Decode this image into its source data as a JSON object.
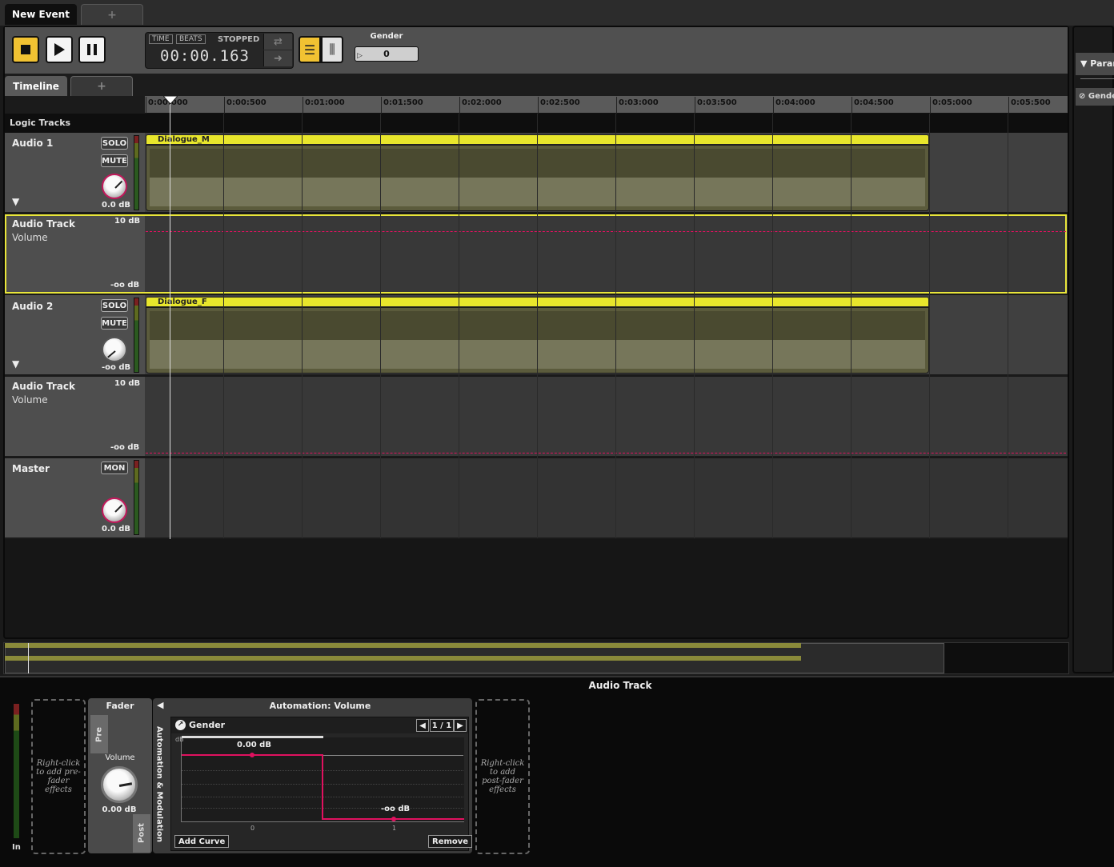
{
  "document_tabs": [
    {
      "label": "New Event"
    },
    {
      "label": "+"
    }
  ],
  "transport": {
    "mode_time": "TIME",
    "mode_beats": "BEATS",
    "status": "STOPPED",
    "time": "00:00.163",
    "loop_icon": "loop-icon",
    "follow_icon": "follow-icon"
  },
  "parameter": {
    "label": "Gender",
    "value": "0"
  },
  "sub_tabs": [
    {
      "label": "Timeline"
    },
    {
      "label": "+"
    }
  ],
  "ruler_ticks": [
    "0:00:000",
    "0:00:500",
    "0:01:000",
    "0:01:500",
    "0:02:000",
    "0:02:500",
    "0:03:000",
    "0:03:500",
    "0:04:000",
    "0:04:500",
    "0:05:000",
    "0:05:500"
  ],
  "logic_tracks_label": "Logic Tracks",
  "tracks": {
    "audio1": {
      "name": "Audio 1",
      "solo": "SOLO",
      "mute": "MUTE",
      "volume": "0.0 dB",
      "region": "Dialogue_M"
    },
    "auto1": {
      "name": "Audio Track",
      "param": "Volume",
      "max": "10 dB",
      "min": "-oo dB"
    },
    "audio2": {
      "name": "Audio 2",
      "solo": "SOLO",
      "mute": "MUTE",
      "volume": "-oo dB",
      "region": "Dialogue_F"
    },
    "auto2": {
      "name": "Audio Track",
      "param": "Volume",
      "max": "10 dB",
      "min": "-oo dB"
    },
    "master": {
      "name": "Master",
      "mon": "MON",
      "volume": "0.0 dB"
    }
  },
  "right_panel": {
    "header": "Parameters",
    "item": "Gender"
  },
  "deck": {
    "title": "Audio Track",
    "input_label": "In",
    "pre_fx_hint": "Right-click to add pre-fader effects",
    "post_fx_hint": "Right-click to add post-fader effects",
    "fader": {
      "title": "Fader",
      "pre": "Pre",
      "post": "Post",
      "volume_label": "Volume",
      "volume_value": "0.00 dB"
    },
    "automation": {
      "side_label": "Automation & Modulation",
      "title": "Automation: Volume",
      "curve_name": "Gender",
      "pager": "1 / 1",
      "y_unit": "dB",
      "point_high_label": "0.00 dB",
      "point_low_label": "-oo dB",
      "x_tick_0": "0",
      "x_tick_1": "1",
      "add_curve": "Add Curve",
      "remove": "Remove"
    }
  },
  "colors": {
    "accent": "#f1c232",
    "region": "#e8e62c",
    "automation_curve": "#e0115f"
  }
}
